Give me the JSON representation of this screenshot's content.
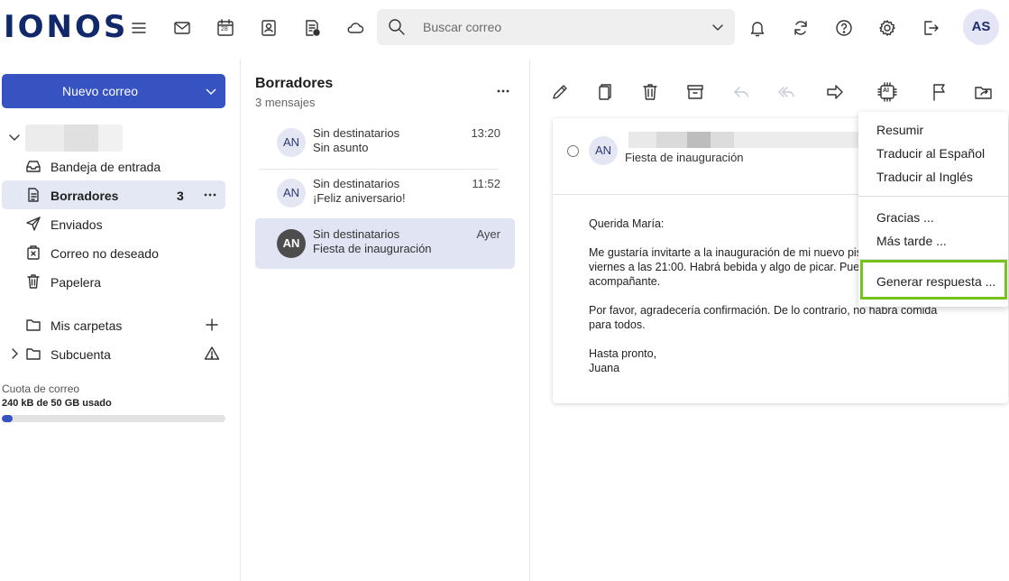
{
  "app": {
    "logo": "IONOS"
  },
  "topbar": {
    "icons": [
      "menu-icon",
      "mail-icon",
      "calendar-icon",
      "contacts-icon",
      "notes-icon",
      "cloud-icon"
    ],
    "calendar_day": "28",
    "search": {
      "placeholder": "Buscar correo"
    },
    "right_icons": [
      "bell-icon",
      "sync-icon",
      "help-icon",
      "gear-icon",
      "logout-icon"
    ],
    "avatar_initials": "AS"
  },
  "sidebar": {
    "compose_label": "Nuevo correo",
    "folders": [
      {
        "label": "Bandeja de entrada",
        "icon": "inbox-icon"
      },
      {
        "label": "Borradores",
        "icon": "drafts-icon",
        "count": "3",
        "active": true
      },
      {
        "label": "Enviados",
        "icon": "sent-icon"
      },
      {
        "label": "Correo no deseado",
        "icon": "spam-icon"
      },
      {
        "label": "Papelera",
        "icon": "trash-icon"
      }
    ],
    "my_folders_label": "Mis carpetas",
    "subaccount_label": "Subcuenta",
    "quota": {
      "label": "Cuota de correo",
      "value": "240 kB de 50 GB usado",
      "fraction": 0.05
    }
  },
  "message_list": {
    "title": "Borradores",
    "count_label": "3 mensajes",
    "messages": [
      {
        "initials": "AN",
        "from": "Sin destinatarios",
        "subject": "Sin asunto",
        "time": "13:20"
      },
      {
        "initials": "AN",
        "from": "Sin destinatarios",
        "subject": "¡Feliz aniversario!",
        "time": "11:52"
      },
      {
        "initials": "AN",
        "from": "Sin destinatarios",
        "subject": "Fiesta de inauguración",
        "time": "Ayer",
        "selected": true
      }
    ]
  },
  "toolbar": {
    "icons": [
      "edit-icon",
      "copy-icon",
      "delete-icon",
      "archive-icon",
      "reply-icon",
      "reply-all-icon",
      "forward-icon",
      "ai-icon",
      "flag-icon",
      "move-icon"
    ],
    "ai_label": "AI"
  },
  "reading_pane": {
    "initials": "AN",
    "subject": "Fiesta de inauguración",
    "body": [
      "Querida María:",
      "Me gustaría invitarte a la inauguración de mi nuevo pis",
      "viernes a las 21:00. Habrá bebida y algo de picar. Pued",
      "acompañante.",
      "Por favor, agradecería confirmación. De lo contrario, no habrá comida",
      "para todos.",
      "Hasta pronto,",
      "Juana"
    ]
  },
  "ai_menu": {
    "items": [
      "Resumir",
      "Traducir al Español",
      "Traducir al Inglés",
      "Gracias ...",
      "Más tarde ...",
      "Generar respuesta ..."
    ],
    "highlight_color": "#78c21e"
  }
}
